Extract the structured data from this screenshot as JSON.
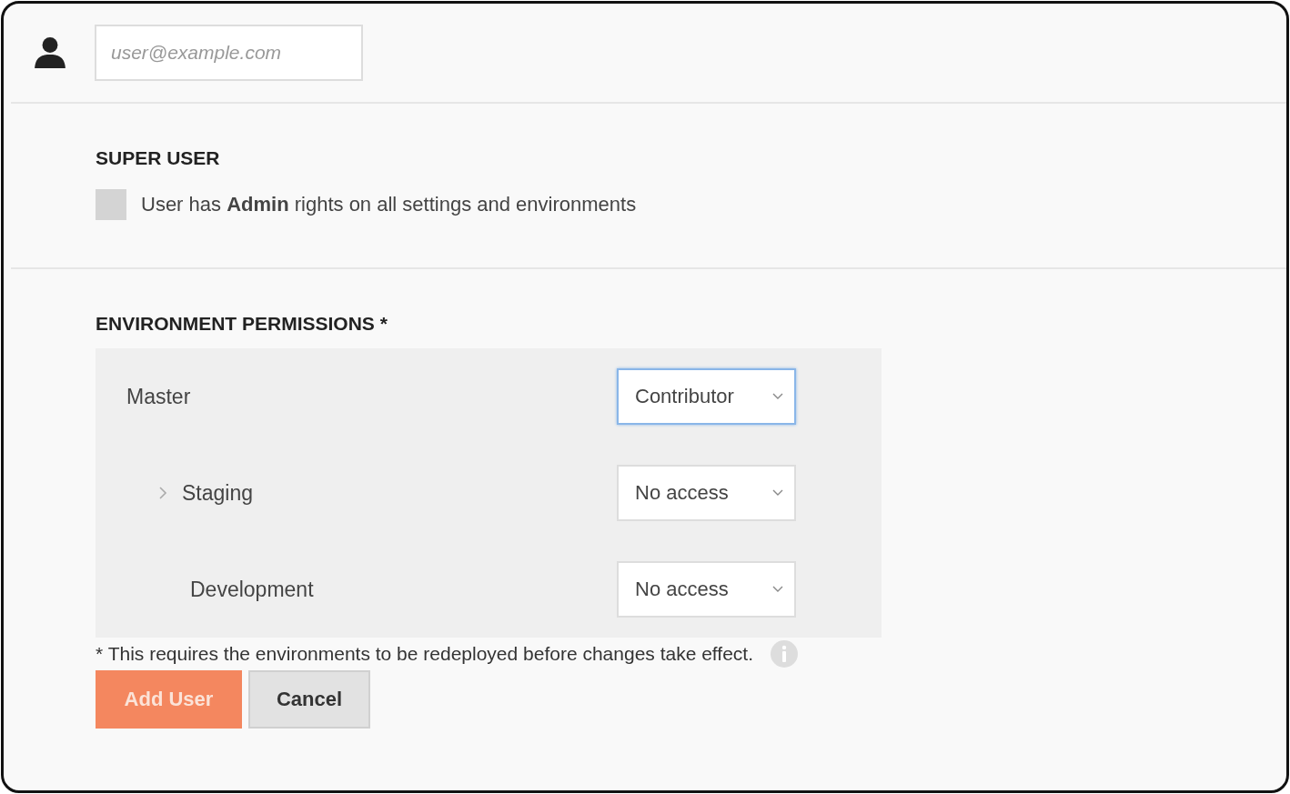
{
  "user": {
    "placeholder": "user@example.com"
  },
  "super_user": {
    "heading": "SUPER USER",
    "label": "User has **Admin** rights on all settings and environments",
    "checked": false
  },
  "permissions": {
    "heading": "ENVIRONMENT PERMISSIONS *",
    "environments": [
      {
        "name": "Master",
        "collapsible": false,
        "access": "Contributor",
        "focused": true,
        "children": [
          {
            "name": "Staging",
            "collapsible": true,
            "access": "No access",
            "focused": false,
            "children": [
              {
                "name": "Development",
                "collapsible": false,
                "access": "No access",
                "focused": false
              }
            ]
          }
        ]
      }
    ],
    "note": "* This requires the environments to be redeployed before changes take effect."
  },
  "buttons": [
    {
      "label": "Add User",
      "kind": "primary"
    },
    {
      "label": "Cancel",
      "kind": "secondary"
    }
  ]
}
